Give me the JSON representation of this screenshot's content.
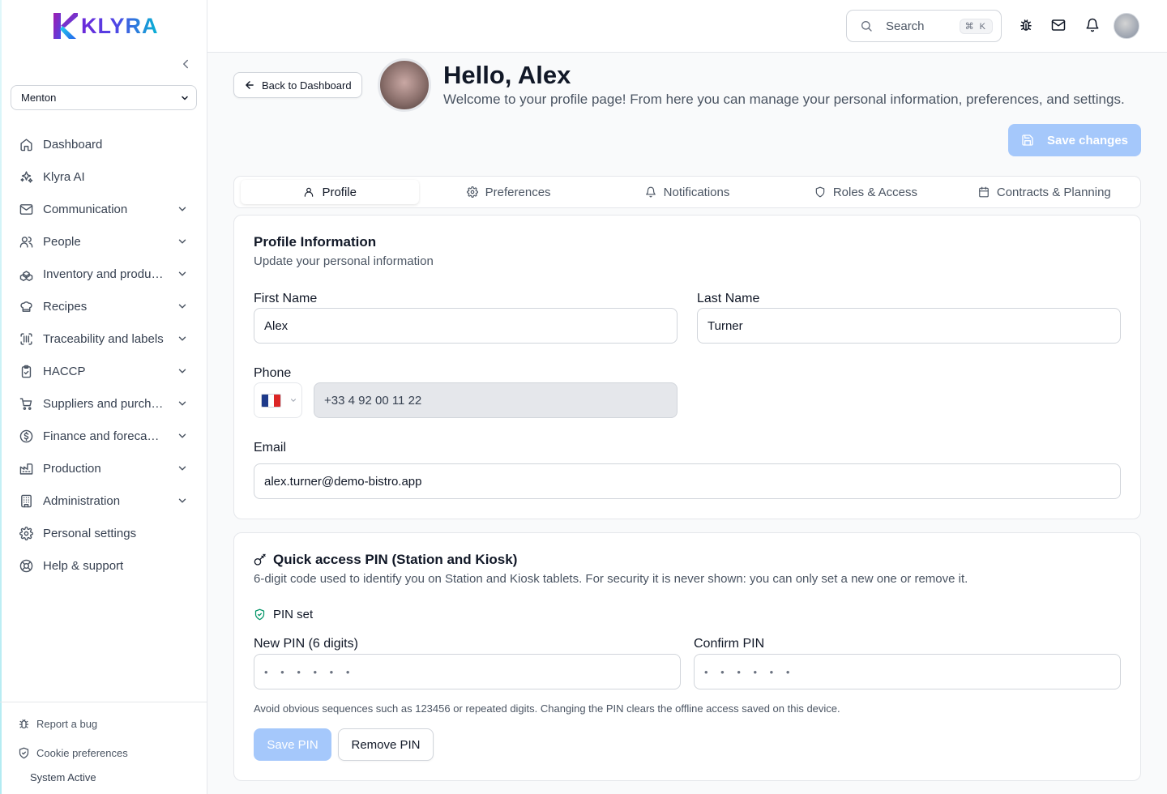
{
  "brand": {
    "name": "KLYRA",
    "colors": {
      "primary": "#6d28d9",
      "accent": "#06b6d4",
      "button_disabled": "#a5c8fb"
    }
  },
  "sidebar": {
    "organization": "Menton",
    "items": [
      {
        "label": "Dashboard",
        "icon": "home-icon",
        "expandable": false
      },
      {
        "label": "Klyra AI",
        "icon": "sparkles-icon",
        "expandable": false
      },
      {
        "label": "Communication",
        "icon": "mail-icon",
        "expandable": true
      },
      {
        "label": "People",
        "icon": "users-icon",
        "expandable": true
      },
      {
        "label": "Inventory and products",
        "icon": "boxes-icon",
        "expandable": true
      },
      {
        "label": "Recipes",
        "icon": "chef-hat-icon",
        "expandable": true
      },
      {
        "label": "Traceability and labels",
        "icon": "scan-barcode-icon",
        "expandable": true
      },
      {
        "label": "HACCP",
        "icon": "clipboard-check-icon",
        "expandable": true
      },
      {
        "label": "Suppliers and purchasing",
        "icon": "cart-icon",
        "expandable": true
      },
      {
        "label": "Finance and forecasting",
        "icon": "dollar-circle-icon",
        "expandable": true
      },
      {
        "label": "Production",
        "icon": "factory-icon",
        "expandable": true
      },
      {
        "label": "Administration",
        "icon": "building-icon",
        "expandable": true
      },
      {
        "label": "Personal settings",
        "icon": "gear-icon",
        "expandable": false
      },
      {
        "label": "Help & support",
        "icon": "life-buoy-icon",
        "expandable": false
      }
    ],
    "footer": {
      "report_bug": "Report a bug",
      "cookie_preferences": "Cookie preferences",
      "system_status": "System Active"
    }
  },
  "topbar": {
    "search_placeholder": "Search",
    "search_shortcut": "⌘ K"
  },
  "header": {
    "back_label": "Back to Dashboard",
    "greeting": "Hello, Alex",
    "welcome": "Welcome to your profile page! From here you can manage your personal information, preferences, and settings.",
    "save_changes": "Save changes"
  },
  "tabs": [
    {
      "label": "Profile",
      "icon": "user-icon",
      "active": true
    },
    {
      "label": "Preferences",
      "icon": "gear-icon",
      "active": false
    },
    {
      "label": "Notifications",
      "icon": "bell-icon",
      "active": false
    },
    {
      "label": "Roles & Access",
      "icon": "shield-icon",
      "active": false
    },
    {
      "label": "Contracts & Planning",
      "icon": "calendar-icon",
      "active": false
    }
  ],
  "profile": {
    "title": "Profile Information",
    "subtitle": "Update your personal information",
    "first_name_label": "First Name",
    "first_name": "Alex",
    "last_name_label": "Last Name",
    "last_name": "Turner",
    "phone_label": "Phone",
    "phone_country": "FR",
    "phone": "+33 4 92 00 11 22",
    "email_label": "Email",
    "email": "alex.turner@demo-bistro.app"
  },
  "pin": {
    "title": "Quick access PIN (Station and Kiosk)",
    "subtitle": "6-digit code used to identify you on Station and Kiosk tablets. For security it is never shown: you can only set a new one or remove it.",
    "status": "PIN set",
    "new_pin_label": "New PIN (6 digits)",
    "new_pin_placeholder": "• • • • • •",
    "confirm_pin_label": "Confirm PIN",
    "confirm_pin_placeholder": "• • • • • •",
    "hint": "Avoid obvious sequences such as 123456 or repeated digits. Changing the PIN clears the offline access saved on this device.",
    "save_label": "Save PIN",
    "remove_label": "Remove PIN"
  }
}
